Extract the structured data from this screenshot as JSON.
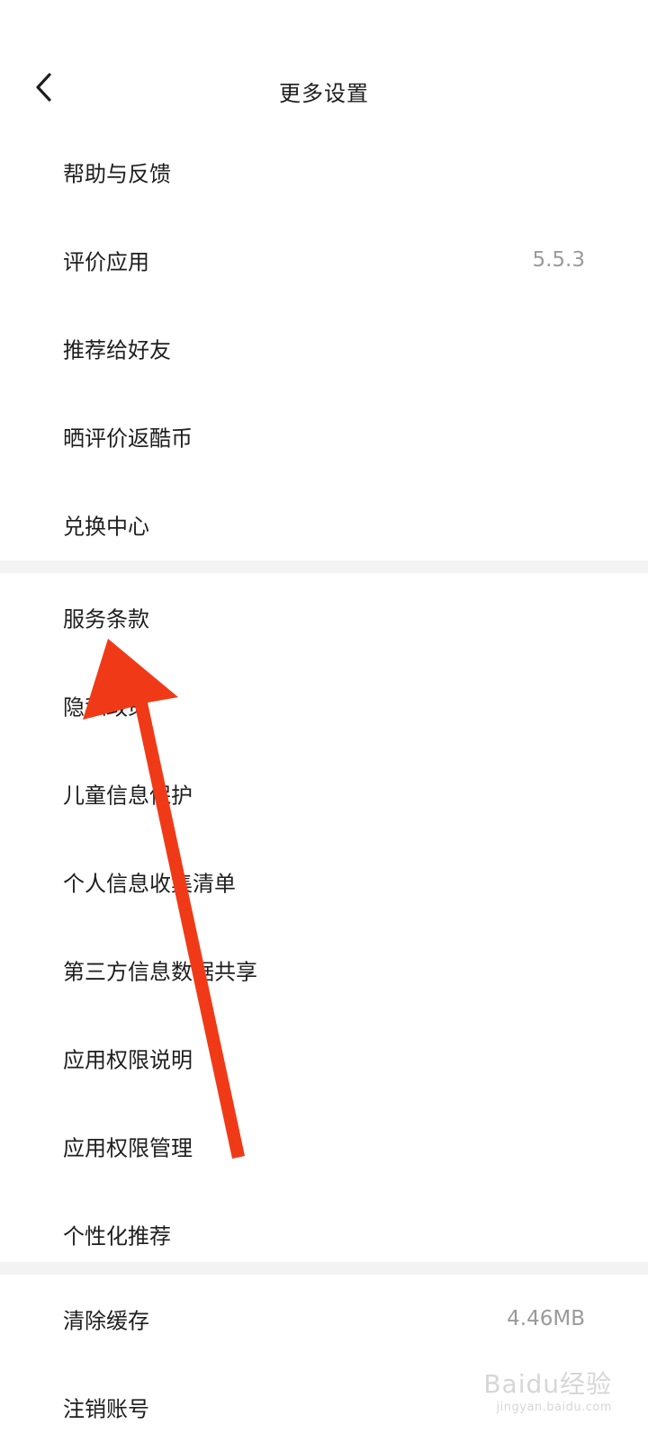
{
  "header": {
    "title": "更多设置",
    "back_icon": "chevron-left-icon"
  },
  "section1": {
    "items": [
      {
        "label": "帮助与反馈",
        "value": ""
      },
      {
        "label": "评价应用",
        "value": "5.5.3"
      },
      {
        "label": "推荐给好友",
        "value": ""
      },
      {
        "label": "晒评价返酷币",
        "value": ""
      },
      {
        "label": "兑换中心",
        "value": ""
      }
    ]
  },
  "section2": {
    "items": [
      {
        "label": "服务条款"
      },
      {
        "label": "隐私政策"
      },
      {
        "label": "儿童信息保护"
      },
      {
        "label": "个人信息收集清单"
      },
      {
        "label": "第三方信息数据共享"
      },
      {
        "label": "应用权限说明"
      },
      {
        "label": "应用权限管理"
      },
      {
        "label": "个性化推荐"
      }
    ]
  },
  "section3": {
    "items": [
      {
        "label": "清除缓存",
        "value": "4.46MB"
      },
      {
        "label": "注销账号",
        "value": ""
      }
    ]
  },
  "annotation": {
    "color": "#f03a17"
  },
  "watermark": {
    "text": "Baidu经验",
    "sub": "jingyan.baidu.com"
  }
}
